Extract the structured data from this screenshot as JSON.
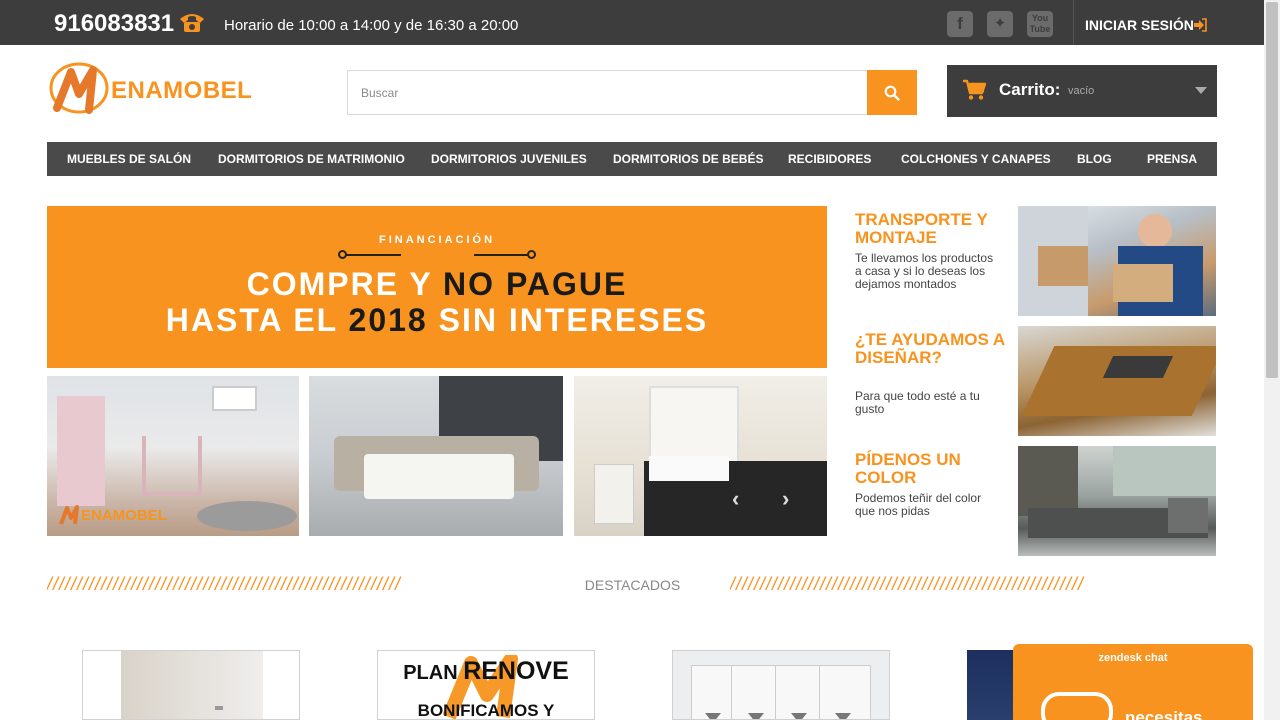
{
  "topbar": {
    "phone": "916083831",
    "hours": "Horario de 10:00 a 14:00 y de 16:30 a 20:00",
    "social": [
      {
        "name": "facebook-icon",
        "glyph": "f"
      },
      {
        "name": "twitter-icon",
        "glyph": "🐦"
      },
      {
        "name": "youtube-icon",
        "glyph": "You Tube"
      }
    ],
    "login_label": "INICIAR SESIÓN"
  },
  "header": {
    "logo_text": "ENAMOBEL",
    "search_placeholder": "Buscar",
    "cart_label": "Carrito:",
    "cart_status": "vacío"
  },
  "nav": {
    "items": [
      "MUEBLES DE SALÓN",
      "DORMITORIOS DE MATRIMONIO",
      "DORMITORIOS JUVENILES",
      "DORMITORIOS DE BEBÉS",
      "RECIBIDORES",
      "COLCHONES Y CANAPES",
      "BLOG",
      "PRENSA"
    ]
  },
  "banner": {
    "kicker": "FINANCIACIÓN",
    "row1_a": "COMPRE Y ",
    "row1_b": "NO PAGUE",
    "row2_a": "HASTA EL ",
    "row2_b": "2018",
    "row2_c": " SIN INTERESES"
  },
  "gallery": {
    "watermark": "ENAMOBEL"
  },
  "features": [
    {
      "title": "TRANSPORTE Y MONTAJE",
      "text": "Te llevamos los productos a casa y si lo deseas los dejamos montados"
    },
    {
      "title": "¿TE AYUDAMOS A DISEÑAR?",
      "text": "Para que todo esté a tu gusto"
    },
    {
      "title": "PÍDENOS UN COLOR",
      "text": "Podemos teñir del color que nos pidas"
    }
  ],
  "section": {
    "destacados": "DESTACADOS"
  },
  "products": {
    "plan_a": "PLAN ",
    "plan_b": "RENOVE",
    "plan_sub": "BONIFICAMOS Y"
  },
  "zendesk": {
    "title": "zendesk chat",
    "text": "necesitas"
  },
  "colors": {
    "accent": "#f7931e",
    "topbar": "#3d3d3d",
    "nav": "#4a4a4a"
  }
}
